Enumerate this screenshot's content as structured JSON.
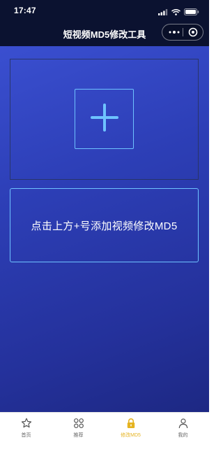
{
  "status_bar": {
    "time": "17:47"
  },
  "nav": {
    "title": "短视频MD5修改工具",
    "capsule_icons": [
      "more-dots-icon",
      "close-circle-icon"
    ]
  },
  "upload": {
    "plus_icon": "plus-icon",
    "hint": "点击上方+号添加视频修改MD5"
  },
  "tabs": [
    {
      "label": "首页",
      "icon": "star-icon",
      "active": false
    },
    {
      "label": "推荐",
      "icon": "grid-icon",
      "active": false
    },
    {
      "label": "修改MD5",
      "icon": "lock-icon",
      "active": true
    },
    {
      "label": "我的",
      "icon": "person-icon",
      "active": false
    }
  ],
  "colors": {
    "accent": "#6ec3ff",
    "active_tab": "#e5b320",
    "nav_bg": "#0b1230",
    "bg_top": "#3a4fd0",
    "bg_bottom": "#1d2883"
  }
}
